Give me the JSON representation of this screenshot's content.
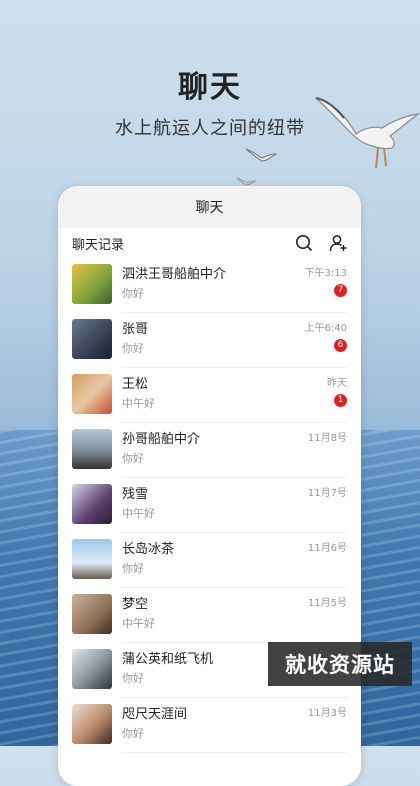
{
  "header": {
    "title": "聊天",
    "subtitle": "水上航运人之间的纽带"
  },
  "app": {
    "bar_title": "聊天",
    "list_title": "聊天记录"
  },
  "icons": {
    "search": "search-icon",
    "add_contact": "add-person-icon"
  },
  "colors": {
    "badge": "#e02020"
  },
  "chats": [
    {
      "name": "泗洪王哥船舶中介",
      "message": "你好",
      "time": "下午3:13",
      "badge": "7"
    },
    {
      "name": "张哥",
      "message": "你好",
      "time": "上午6:40",
      "badge": "6"
    },
    {
      "name": "王松",
      "message": "中午好",
      "time": "昨天",
      "badge": "1"
    },
    {
      "name": "孙哥船舶中介",
      "message": "你好",
      "time": "11月8号"
    },
    {
      "name": "残雪",
      "message": "中午好",
      "time": "11月7号"
    },
    {
      "name": "长岛冰茶",
      "message": "你好",
      "time": "11月6号"
    },
    {
      "name": "梦空",
      "message": "中午好",
      "time": "11月5号"
    },
    {
      "name": "蒲公英和纸飞机",
      "message": "你好",
      "time": ""
    },
    {
      "name": "咫尺天涯间",
      "message": "你好",
      "time": "11月3号"
    }
  ],
  "watermark": "就收资源站"
}
